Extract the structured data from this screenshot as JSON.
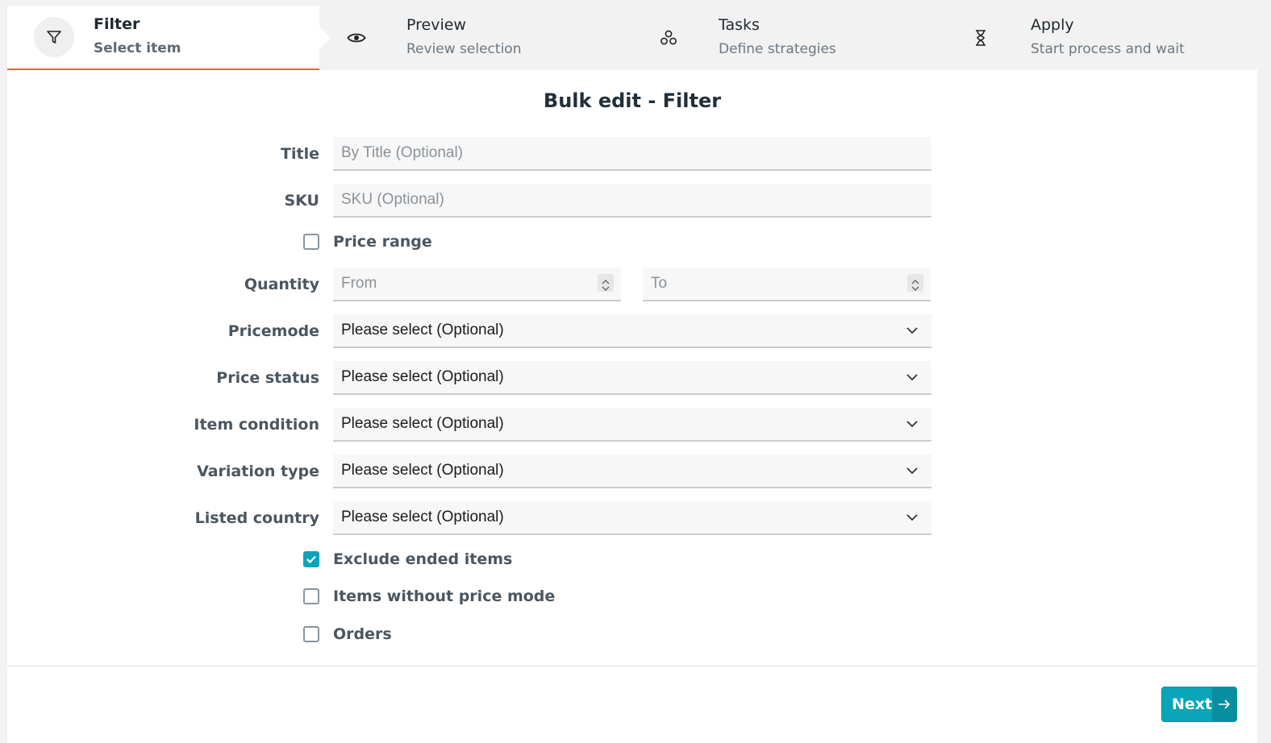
{
  "stepper": {
    "steps": [
      {
        "title": "Filter",
        "subtitle": "Select item",
        "icon": "filter-icon",
        "active": true
      },
      {
        "title": "Preview",
        "subtitle": "Review selection",
        "icon": "eye-icon",
        "active": false
      },
      {
        "title": "Tasks",
        "subtitle": "Define strategies",
        "icon": "tasks-icon",
        "active": false
      },
      {
        "title": "Apply",
        "subtitle": "Start process and wait",
        "icon": "hourglass-icon",
        "active": false
      }
    ],
    "active_color": "#e8604a"
  },
  "form": {
    "title": "Bulk edit - Filter",
    "title_field": {
      "label": "Title",
      "placeholder": "By Title (Optional)"
    },
    "sku_field": {
      "label": "SKU",
      "placeholder": "SKU (Optional)"
    },
    "price_range": {
      "label": "Price range",
      "checked": false
    },
    "quantity": {
      "label": "Quantity",
      "from_placeholder": "From",
      "to_placeholder": "To"
    },
    "pricemode": {
      "label": "Pricemode",
      "value": "Please select (Optional)"
    },
    "price_status": {
      "label": "Price status",
      "value": "Please select (Optional)"
    },
    "item_condition": {
      "label": "Item condition",
      "value": "Please select (Optional)"
    },
    "variation_type": {
      "label": "Variation type",
      "value": "Please select (Optional)"
    },
    "listed_country": {
      "label": "Listed country",
      "value": "Please select (Optional)"
    },
    "exclude_ended": {
      "label": "Exclude ended items",
      "checked": true
    },
    "without_price_mode": {
      "label": "Items without price mode",
      "checked": false
    },
    "orders": {
      "label": "Orders",
      "checked": false
    }
  },
  "footer": {
    "next_label": "Next",
    "accent": "#0aa5b8"
  }
}
